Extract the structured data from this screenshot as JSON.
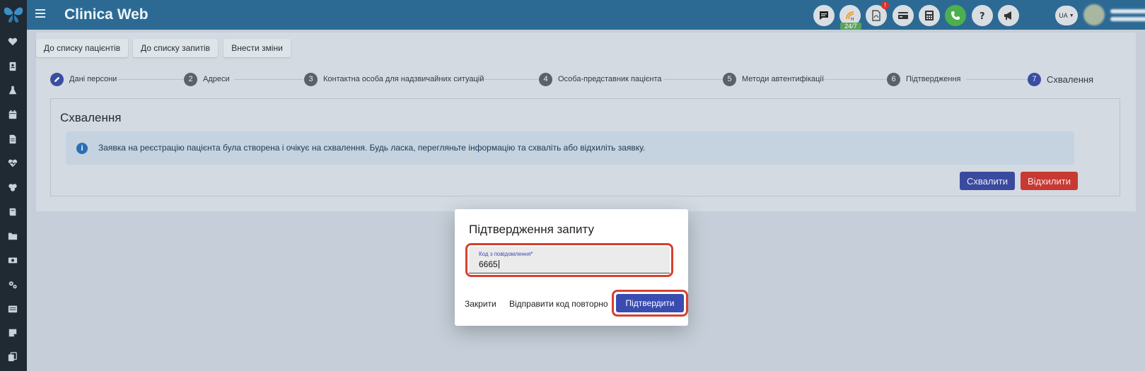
{
  "app": {
    "title": "Clinica Web"
  },
  "topbar": {
    "support_badge": "24/7",
    "alert_count": "!",
    "language": "UA"
  },
  "sidebar": {
    "icons": [
      "heart-icon",
      "id-card-icon",
      "flask-icon",
      "calendar-icon",
      "document-icon",
      "heartbeat-icon",
      "pills-icon",
      "book-icon",
      "folder-icon",
      "money-icon",
      "settings-icon",
      "list-icon",
      "note-icon",
      "copy-icon"
    ]
  },
  "nav": {
    "patients_list": "До списку пацієнтів",
    "requests_list": "До списку запитів",
    "edit": "Внести зміни"
  },
  "steps": [
    {
      "num": "",
      "label": "Дані персони"
    },
    {
      "num": "2",
      "label": "Адреси"
    },
    {
      "num": "3",
      "label": "Контактна особа для надзвичайних ситуацій"
    },
    {
      "num": "4",
      "label": "Особа-представник пацієнта"
    },
    {
      "num": "5",
      "label": "Методи автентифікації"
    },
    {
      "num": "6",
      "label": "Підтвердження"
    },
    {
      "num": "7",
      "label": "Схвалення"
    }
  ],
  "card": {
    "title": "Схвалення",
    "alert_text": "Заявка на реєстрацію пацієнта була створена і очікує на схвалення. Будь ласка, перегляньте інформацію та схваліть або відхиліть заявку.",
    "approve_label": "Схвалити",
    "reject_label": "Відхилити"
  },
  "modal": {
    "title": "Підтвердження запиту",
    "code_label": "Код з повідомлення*",
    "code_value": "6665",
    "close_label": "Закрити",
    "resend_label": "Відправити код повторно",
    "confirm_label": "Підтвердити"
  },
  "colors": {
    "topbar": "#2c6a94",
    "sidebar": "#1f2a33",
    "primary": "#3a4cb0",
    "danger": "#c83934",
    "highlight": "#d7412f"
  }
}
